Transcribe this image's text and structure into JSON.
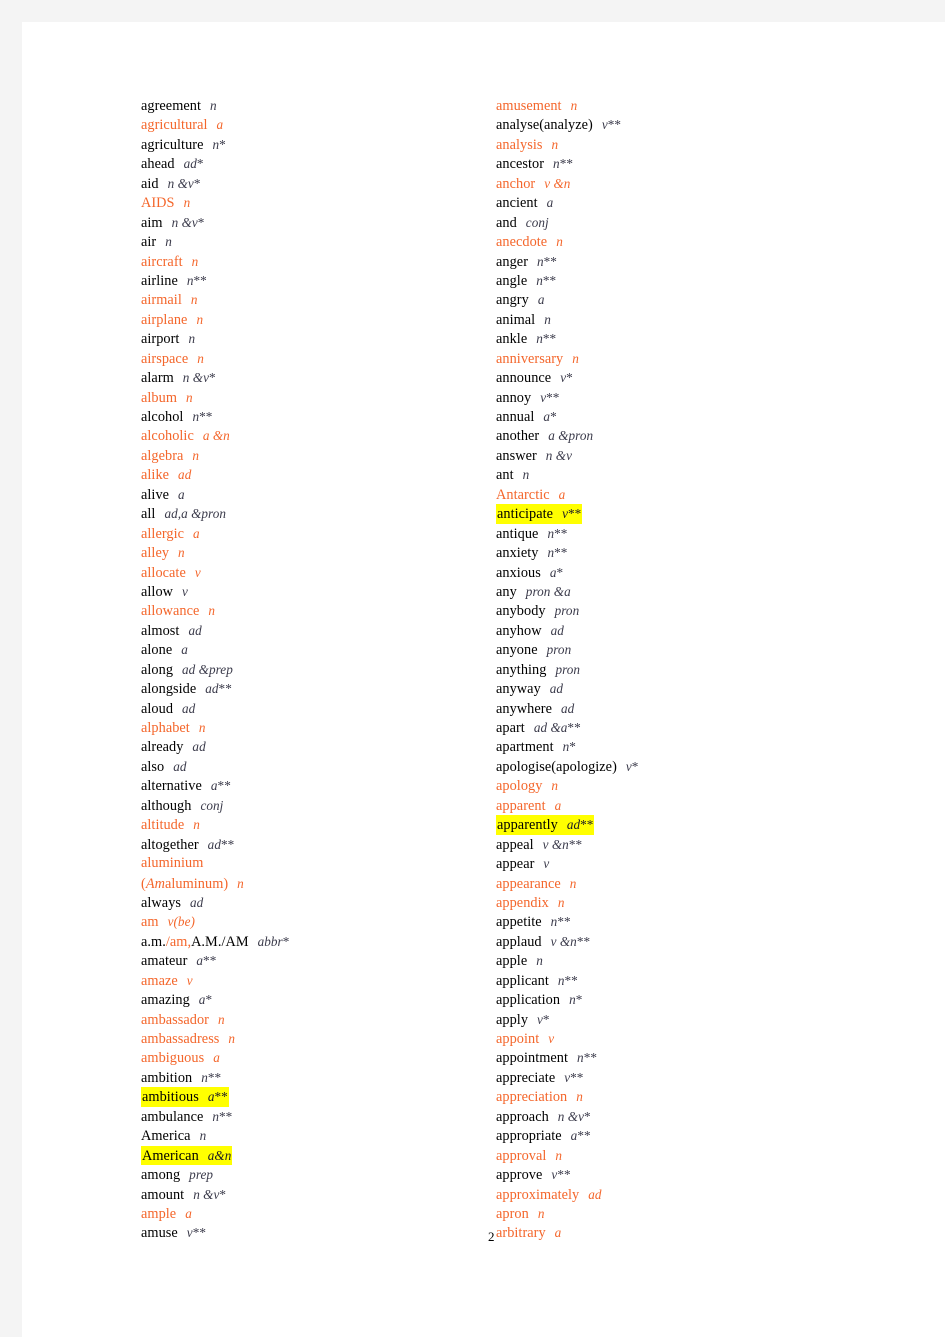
{
  "document": {
    "page_number": "2",
    "accent_color": "#f4662b",
    "highlight_color": "#ffff00",
    "page_background": "#ffffff",
    "canvas_background": "#f4f4f4"
  },
  "columns": {
    "left": [
      {
        "word": "agreement",
        "pos": "n",
        "stars": "",
        "color": "black",
        "highlight": false
      },
      {
        "word": "agricultural",
        "pos": "a",
        "stars": "",
        "color": "orange",
        "highlight": false
      },
      {
        "word": "agriculture",
        "pos": "n",
        "stars": "*",
        "color": "black",
        "highlight": false
      },
      {
        "word": "ahead",
        "pos": "ad",
        "stars": "*",
        "color": "black",
        "highlight": false
      },
      {
        "word": "aid",
        "pos": "n  &v",
        "stars": "*",
        "color": "black",
        "highlight": false
      },
      {
        "word": "AIDS",
        "pos": "n",
        "stars": "",
        "color": "orange",
        "highlight": false
      },
      {
        "word": "aim",
        "pos": "n  &v",
        "stars": "*",
        "color": "black",
        "highlight": false
      },
      {
        "word": "air",
        "pos": "n",
        "stars": "",
        "color": "black",
        "highlight": false
      },
      {
        "word": "aircraft",
        "pos": "n",
        "stars": "",
        "color": "orange",
        "highlight": false
      },
      {
        "word": "airline",
        "pos": "n",
        "stars": "**",
        "color": "black",
        "highlight": false
      },
      {
        "word": "airmail",
        "pos": "n",
        "stars": "",
        "color": "orange",
        "highlight": false
      },
      {
        "word": "airplane",
        "pos": "n",
        "stars": "",
        "color": "orange",
        "highlight": false
      },
      {
        "word": "airport",
        "pos": "n",
        "stars": "",
        "color": "black",
        "highlight": false
      },
      {
        "word": "airspace",
        "pos": "n",
        "stars": "",
        "color": "orange",
        "highlight": false
      },
      {
        "word": "alarm",
        "pos": "n  &v",
        "stars": "*",
        "color": "black",
        "highlight": false
      },
      {
        "word": "album",
        "pos": "n",
        "stars": "",
        "color": "orange",
        "highlight": false
      },
      {
        "word": "alcohol",
        "pos": "n",
        "stars": "**",
        "color": "black",
        "highlight": false
      },
      {
        "word": "alcoholic",
        "pos": "a  &n",
        "stars": "",
        "color": "orange",
        "highlight": false
      },
      {
        "word": "algebra",
        "pos": "n",
        "stars": "",
        "color": "orange",
        "highlight": false
      },
      {
        "word": "alike",
        "pos": "ad",
        "stars": "",
        "color": "orange",
        "highlight": false
      },
      {
        "word": "alive",
        "pos": "a",
        "stars": "",
        "color": "black",
        "highlight": false
      },
      {
        "word": "all",
        "pos": "ad,a  &pron",
        "stars": "",
        "color": "black",
        "highlight": false
      },
      {
        "word": "allergic",
        "pos": "a",
        "stars": "",
        "color": "orange",
        "highlight": false
      },
      {
        "word": "alley",
        "pos": "n",
        "stars": "",
        "color": "orange",
        "highlight": false
      },
      {
        "word": "allocate",
        "pos": "v",
        "stars": "",
        "color": "orange",
        "highlight": false
      },
      {
        "word": "allow",
        "pos": "v",
        "stars": "",
        "color": "black",
        "highlight": false
      },
      {
        "word": "allowance",
        "pos": "n",
        "stars": "",
        "color": "orange",
        "highlight": false
      },
      {
        "word": "almost",
        "pos": "ad",
        "stars": "",
        "color": "black",
        "highlight": false
      },
      {
        "word": "alone",
        "pos": "a",
        "stars": "",
        "color": "black",
        "highlight": false
      },
      {
        "word": "along",
        "pos": "ad  &prep",
        "stars": "",
        "color": "black",
        "highlight": false
      },
      {
        "word": "alongside",
        "pos": "ad",
        "stars": "**",
        "color": "black",
        "highlight": false
      },
      {
        "word": "aloud",
        "pos": "ad",
        "stars": "",
        "color": "black",
        "highlight": false
      },
      {
        "word": "alphabet",
        "pos": "n",
        "stars": "",
        "color": "orange",
        "highlight": false
      },
      {
        "word": "already",
        "pos": "ad",
        "stars": "",
        "color": "black",
        "highlight": false
      },
      {
        "word": "also",
        "pos": "ad",
        "stars": "",
        "color": "black",
        "highlight": false
      },
      {
        "word": "alternative",
        "pos": "a",
        "stars": "**",
        "color": "black",
        "highlight": false
      },
      {
        "word": "although",
        "pos": "conj",
        "stars": "",
        "color": "black",
        "highlight": false
      },
      {
        "word": "altitude",
        "pos": "n",
        "stars": "",
        "color": "orange",
        "highlight": false
      },
      {
        "word": "altogether",
        "pos": "ad",
        "stars": "**",
        "color": "black",
        "highlight": false
      },
      {
        "word": "aluminium",
        "pos": "",
        "stars": "",
        "color": "orange",
        "highlight": false
      },
      {
        "word": "(Amaluminum)",
        "pos": "n",
        "stars": "",
        "color": "orange",
        "highlight": false,
        "italic_prefix": "Am"
      },
      {
        "word": "always",
        "pos": "ad",
        "stars": "",
        "color": "black",
        "highlight": false
      },
      {
        "word": "am",
        "pos": "v(be)",
        "stars": "",
        "color": "orange",
        "highlight": false
      },
      {
        "word": "a.m./am,A.M./AM",
        "pos": "abbr",
        "stars": "*",
        "color": "black",
        "highlight": false,
        "mixed": true
      },
      {
        "word": "amateur",
        "pos": "a",
        "stars": "**",
        "color": "black",
        "highlight": false
      },
      {
        "word": "amaze",
        "pos": "v",
        "stars": "",
        "color": "orange",
        "highlight": false
      },
      {
        "word": "amazing",
        "pos": "a",
        "stars": "*",
        "color": "black",
        "highlight": false
      },
      {
        "word": "ambassador",
        "pos": "n",
        "stars": "",
        "color": "orange",
        "highlight": false
      },
      {
        "word": "ambassadress",
        "pos": "n",
        "stars": "",
        "color": "orange",
        "highlight": false
      },
      {
        "word": "ambiguous",
        "pos": "a",
        "stars": "",
        "color": "orange",
        "highlight": false
      },
      {
        "word": "ambition",
        "pos": "n",
        "stars": "**",
        "color": "black",
        "highlight": false
      },
      {
        "word": "ambitious",
        "pos": "a",
        "stars": "**",
        "color": "black",
        "highlight": true
      },
      {
        "word": "ambulance",
        "pos": "n",
        "stars": "**",
        "color": "black",
        "highlight": false
      },
      {
        "word": "America",
        "pos": "n",
        "stars": "",
        "color": "black",
        "highlight": false
      },
      {
        "word": "American",
        "pos": "a&n",
        "stars": "",
        "color": "black",
        "highlight": true
      },
      {
        "word": "among",
        "pos": "prep",
        "stars": "",
        "color": "black",
        "highlight": false
      },
      {
        "word": "amount",
        "pos": "n  &v",
        "stars": "*",
        "color": "black",
        "highlight": false
      },
      {
        "word": "ample",
        "pos": "a",
        "stars": "",
        "color": "orange",
        "highlight": false
      },
      {
        "word": "amuse",
        "pos": "v",
        "stars": "**",
        "color": "black",
        "highlight": false
      }
    ],
    "right": [
      {
        "word": "amusement",
        "pos": "n",
        "stars": "",
        "color": "orange",
        "highlight": false
      },
      {
        "word": "analyse(analyze)",
        "pos": "v",
        "stars": "**",
        "color": "black",
        "highlight": false
      },
      {
        "word": "analysis",
        "pos": "n",
        "stars": "",
        "color": "orange",
        "highlight": false
      },
      {
        "word": "ancestor",
        "pos": "n",
        "stars": "**",
        "color": "black",
        "highlight": false
      },
      {
        "word": "anchor",
        "pos": "v  &n",
        "stars": "",
        "color": "orange",
        "highlight": false
      },
      {
        "word": "ancient",
        "pos": "a",
        "stars": "",
        "color": "black",
        "highlight": false
      },
      {
        "word": "and",
        "pos": "conj",
        "stars": "",
        "color": "black",
        "highlight": false
      },
      {
        "word": "anecdote",
        "pos": "n",
        "stars": "",
        "color": "orange",
        "highlight": false
      },
      {
        "word": "anger",
        "pos": "n",
        "stars": "**",
        "color": "black",
        "highlight": false
      },
      {
        "word": "angle",
        "pos": "n",
        "stars": "**",
        "color": "black",
        "highlight": false
      },
      {
        "word": "angry",
        "pos": "a",
        "stars": "",
        "color": "black",
        "highlight": false
      },
      {
        "word": "animal",
        "pos": "n",
        "stars": "",
        "color": "black",
        "highlight": false
      },
      {
        "word": "ankle",
        "pos": "n",
        "stars": "**",
        "color": "black",
        "highlight": false
      },
      {
        "word": "anniversary",
        "pos": "n",
        "stars": "",
        "color": "orange",
        "highlight": false
      },
      {
        "word": "announce",
        "pos": "v",
        "stars": "*",
        "color": "black",
        "highlight": false
      },
      {
        "word": "annoy",
        "pos": "v",
        "stars": "**",
        "color": "black",
        "highlight": false
      },
      {
        "word": "annual",
        "pos": "a",
        "stars": "*",
        "color": "black",
        "highlight": false
      },
      {
        "word": "another",
        "pos": "a  &pron",
        "stars": "",
        "color": "black",
        "highlight": false
      },
      {
        "word": "answer",
        "pos": "n  &v",
        "stars": "",
        "color": "black",
        "highlight": false
      },
      {
        "word": "ant",
        "pos": "n",
        "stars": "",
        "color": "black",
        "highlight": false
      },
      {
        "word": "Antarctic",
        "pos": "a",
        "stars": "",
        "color": "orange",
        "highlight": false
      },
      {
        "word": "anticipate",
        "pos": "v",
        "stars": "**",
        "color": "black",
        "highlight": true
      },
      {
        "word": "antique",
        "pos": "n",
        "stars": "**",
        "color": "black",
        "highlight": false
      },
      {
        "word": "anxiety",
        "pos": "n",
        "stars": "**",
        "color": "black",
        "highlight": false
      },
      {
        "word": "anxious",
        "pos": "a",
        "stars": "*",
        "color": "black",
        "highlight": false
      },
      {
        "word": "any",
        "pos": "pron  &a",
        "stars": "",
        "color": "black",
        "highlight": false
      },
      {
        "word": "anybody",
        "pos": "pron",
        "stars": "",
        "color": "black",
        "highlight": false
      },
      {
        "word": "anyhow",
        "pos": "ad",
        "stars": "",
        "color": "black",
        "highlight": false
      },
      {
        "word": "anyone",
        "pos": "pron",
        "stars": "",
        "color": "black",
        "highlight": false
      },
      {
        "word": "anything",
        "pos": "pron",
        "stars": "",
        "color": "black",
        "highlight": false
      },
      {
        "word": "anyway",
        "pos": "ad",
        "stars": "",
        "color": "black",
        "highlight": false
      },
      {
        "word": "anywhere",
        "pos": "ad",
        "stars": "",
        "color": "black",
        "highlight": false
      },
      {
        "word": "apart",
        "pos": "ad  &a",
        "stars": "**",
        "color": "black",
        "highlight": false
      },
      {
        "word": "apartment",
        "pos": "n",
        "stars": "*",
        "color": "black",
        "highlight": false
      },
      {
        "word": "apologise(apologize)",
        "pos": "v",
        "stars": "*",
        "color": "black",
        "highlight": false
      },
      {
        "word": "apology",
        "pos": "n",
        "stars": "",
        "color": "orange",
        "highlight": false
      },
      {
        "word": "apparent",
        "pos": "a",
        "stars": "",
        "color": "orange",
        "highlight": false
      },
      {
        "word": "apparently",
        "pos": "ad",
        "stars": "**",
        "color": "black",
        "highlight": true
      },
      {
        "word": "appeal",
        "pos": "v  &n",
        "stars": "**",
        "color": "black",
        "highlight": false
      },
      {
        "word": "appear",
        "pos": "v",
        "stars": "",
        "color": "black",
        "highlight": false
      },
      {
        "word": "appearance",
        "pos": "n",
        "stars": "",
        "color": "orange",
        "highlight": false
      },
      {
        "word": "appendix",
        "pos": "n",
        "stars": "",
        "color": "orange",
        "highlight": false
      },
      {
        "word": "appetite",
        "pos": "n",
        "stars": "**",
        "color": "black",
        "highlight": false
      },
      {
        "word": "applaud",
        "pos": "v  &n",
        "stars": "**",
        "color": "black",
        "highlight": false
      },
      {
        "word": "apple",
        "pos": "n",
        "stars": "",
        "color": "black",
        "highlight": false
      },
      {
        "word": "applicant",
        "pos": "n",
        "stars": "**",
        "color": "black",
        "highlight": false
      },
      {
        "word": "application",
        "pos": "n",
        "stars": "*",
        "color": "black",
        "highlight": false
      },
      {
        "word": "apply",
        "pos": "v",
        "stars": "*",
        "color": "black",
        "highlight": false
      },
      {
        "word": "appoint",
        "pos": "v",
        "stars": "",
        "color": "orange",
        "highlight": false
      },
      {
        "word": "appointment",
        "pos": "n",
        "stars": "**",
        "color": "black",
        "highlight": false
      },
      {
        "word": "appreciate",
        "pos": "v",
        "stars": "**",
        "color": "black",
        "highlight": false
      },
      {
        "word": "appreciation",
        "pos": "n",
        "stars": "",
        "color": "orange",
        "highlight": false
      },
      {
        "word": "approach",
        "pos": "n  &v",
        "stars": "*",
        "color": "black",
        "highlight": false
      },
      {
        "word": "appropriate",
        "pos": "a",
        "stars": "**",
        "color": "black",
        "highlight": false
      },
      {
        "word": "approval",
        "pos": "n",
        "stars": "",
        "color": "orange",
        "highlight": false
      },
      {
        "word": "approve",
        "pos": "v",
        "stars": "**",
        "color": "black",
        "highlight": false
      },
      {
        "word": "approximately",
        "pos": "ad",
        "stars": "",
        "color": "orange",
        "highlight": false
      },
      {
        "word": "apron",
        "pos": "n",
        "stars": "",
        "color": "orange",
        "highlight": false
      },
      {
        "word": "arbitrary",
        "pos": "a",
        "stars": "",
        "color": "orange",
        "highlight": false
      }
    ]
  }
}
